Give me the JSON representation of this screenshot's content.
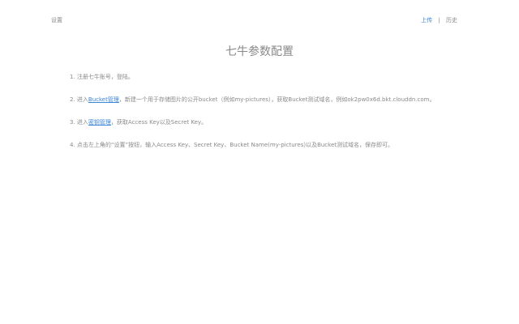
{
  "topbar": {
    "settings_label": "设置",
    "upload_label": "上传",
    "separator": "|",
    "history_label": "历史"
  },
  "title": "七牛参数配置",
  "steps": [
    {
      "prefix": "1. 注册七牛账号，登陆。",
      "link": "",
      "suffix": ""
    },
    {
      "prefix": "2. 进入",
      "link": "Bucket管理",
      "suffix": "，新建一个用于存储图片的公开bucket（例如my-pictures），获取Bucket测试域名，例如ok2pw0x6d.bkt.clouddn.com。"
    },
    {
      "prefix": "3. 进入",
      "link": "密钥管理",
      "suffix": "，获取Access Key以及Secret Key。"
    },
    {
      "prefix": "4. 点击左上角的“设置”按钮，输入Access Key、Secret Key、Bucket Name(my-pictures)以及Bucket测试域名，保存即可。",
      "link": "",
      "suffix": ""
    }
  ],
  "colors": {
    "text": "#8a8a8a",
    "link": "#3a86d8",
    "background": "#ffffff"
  }
}
